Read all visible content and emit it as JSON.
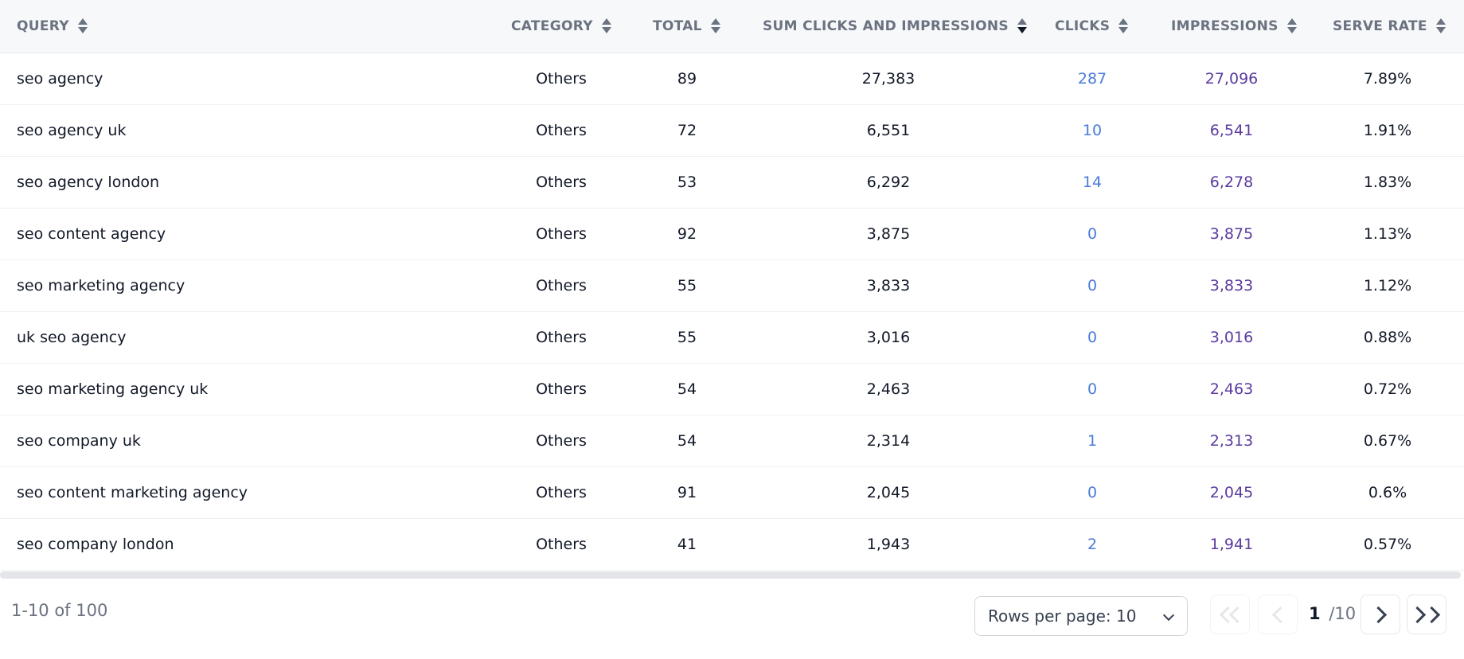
{
  "columns": [
    {
      "key": "query",
      "label": "QUERY"
    },
    {
      "key": "category",
      "label": "CATEGORY"
    },
    {
      "key": "total",
      "label": "TOTAL"
    },
    {
      "key": "sum",
      "label": "SUM CLICKS AND IMPRESSIONS",
      "sorted": "desc"
    },
    {
      "key": "clicks",
      "label": "CLICKS"
    },
    {
      "key": "impressions",
      "label": "IMPRESSIONS"
    },
    {
      "key": "serve_rate",
      "label": "SERVE RATE"
    }
  ],
  "rows": [
    {
      "query": "seo agency",
      "category": "Others",
      "total": "89",
      "sum": "27,383",
      "clicks": "287",
      "impressions": "27,096",
      "serve_rate": "7.89%"
    },
    {
      "query": "seo agency uk",
      "category": "Others",
      "total": "72",
      "sum": "6,551",
      "clicks": "10",
      "impressions": "6,541",
      "serve_rate": "1.91%"
    },
    {
      "query": "seo agency london",
      "category": "Others",
      "total": "53",
      "sum": "6,292",
      "clicks": "14",
      "impressions": "6,278",
      "serve_rate": "1.83%"
    },
    {
      "query": "seo content agency",
      "category": "Others",
      "total": "92",
      "sum": "3,875",
      "clicks": "0",
      "impressions": "3,875",
      "serve_rate": "1.13%"
    },
    {
      "query": "seo marketing agency",
      "category": "Others",
      "total": "55",
      "sum": "3,833",
      "clicks": "0",
      "impressions": "3,833",
      "serve_rate": "1.12%"
    },
    {
      "query": "uk seo agency",
      "category": "Others",
      "total": "55",
      "sum": "3,016",
      "clicks": "0",
      "impressions": "3,016",
      "serve_rate": "0.88%"
    },
    {
      "query": "seo marketing agency uk",
      "category": "Others",
      "total": "54",
      "sum": "2,463",
      "clicks": "0",
      "impressions": "2,463",
      "serve_rate": "0.72%"
    },
    {
      "query": "seo company uk",
      "category": "Others",
      "total": "54",
      "sum": "2,314",
      "clicks": "1",
      "impressions": "2,313",
      "serve_rate": "0.67%"
    },
    {
      "query": "seo content marketing agency",
      "category": "Others",
      "total": "91",
      "sum": "2,045",
      "clicks": "0",
      "impressions": "2,045",
      "serve_rate": "0.6%"
    },
    {
      "query": "seo company london",
      "category": "Others",
      "total": "41",
      "sum": "1,943",
      "clicks": "2",
      "impressions": "1,941",
      "serve_rate": "0.57%"
    }
  ],
  "footer": {
    "range_text": "1-10 of 100",
    "rows_per_page_label": "Rows per page: 10",
    "current_page": "1",
    "total_pages": "/10"
  },
  "colors": {
    "clicks": "#4a7bd8",
    "impressions": "#5b3aa0",
    "header_bg": "#f7f8fa"
  },
  "icons": {
    "sort": "sort-arrows-icon",
    "first": "double-chevron-left-icon",
    "prev": "chevron-left-icon",
    "next": "chevron-right-icon",
    "last": "double-chevron-right-icon",
    "select": "chevron-down-icon"
  }
}
